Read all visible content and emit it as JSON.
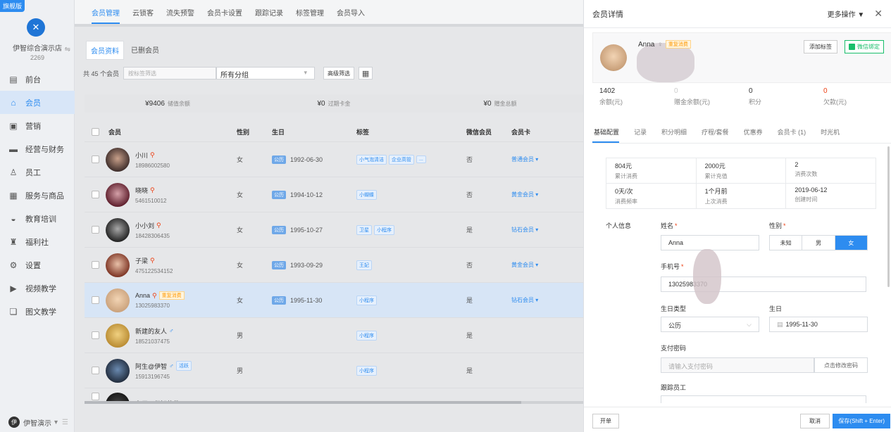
{
  "sidebar": {
    "badge": "旗舰版",
    "store_name": "伊智综合演示店",
    "store_id": "2269",
    "switch_icon": "switch-icon",
    "items": [
      {
        "label": "前台",
        "icon": "desk-icon"
      },
      {
        "label": "会员",
        "icon": "member-icon",
        "active": true
      },
      {
        "label": "营销",
        "icon": "marketing-icon"
      },
      {
        "label": "经营与财务",
        "icon": "finance-icon"
      },
      {
        "label": "员工",
        "icon": "staff-icon"
      },
      {
        "label": "服务与商品",
        "icon": "goods-icon"
      },
      {
        "label": "教育培训",
        "icon": "education-icon"
      },
      {
        "label": "福利社",
        "icon": "welfare-icon"
      },
      {
        "label": "设置",
        "icon": "settings-icon"
      },
      {
        "label": "视频教学",
        "icon": "video-icon"
      },
      {
        "label": "图文教学",
        "icon": "article-icon"
      }
    ],
    "user": "伊智演示",
    "user_avatar_text": "伊"
  },
  "topnav": [
    "会员管理",
    "云锁客",
    "流失预警",
    "会员卡设置",
    "跟踪记录",
    "标签管理",
    "会员导入"
  ],
  "subtabs": [
    "会员资料",
    "已删会员"
  ],
  "filter": {
    "count": "共 45 个会员",
    "placeholder": "按标签筛选",
    "group": "所有分组",
    "advanced": "高级筛选"
  },
  "summary": [
    {
      "value": "¥9406",
      "label": "储值余额"
    },
    {
      "value": "¥0",
      "label": "过期卡金"
    },
    {
      "value": "¥0",
      "label": "赠金总额"
    }
  ],
  "table": {
    "headers": [
      "会员",
      "性别",
      "生日",
      "标签",
      "微信会员",
      "会员卡"
    ],
    "rows": [
      {
        "name": "小川",
        "phone": "18986002580",
        "gender": "女",
        "gicon": "female",
        "cal": "公历",
        "birthday": "1992-06-30",
        "tags": [
          "小气泡清洁",
          "企业高管",
          "..."
        ],
        "wechat": "否",
        "card": "普通会员",
        "avatar": [
          "#3a2a28",
          "#c8a08a"
        ]
      },
      {
        "name": "晓晓",
        "phone": "5461510012",
        "gender": "女",
        "gicon": "female",
        "cal": "公历",
        "birthday": "1994-10-12",
        "tags": [
          "小蝴蝶"
        ],
        "wechat": "否",
        "card": "黄金会员",
        "avatar": [
          "#5a1a28",
          "#d4a0a8"
        ]
      },
      {
        "name": "小小刘",
        "phone": "18428306435",
        "gender": "女",
        "gicon": "female",
        "cal": "公历",
        "birthday": "1995-10-27",
        "tags": [
          "卫星",
          "小程序"
        ],
        "wechat": "是",
        "card": "钻石会员",
        "avatar": [
          "#1e1e1e",
          "#a8a8a8"
        ]
      },
      {
        "name": "子梁",
        "phone": "475122534152",
        "gender": "女",
        "gicon": "female",
        "cal": "公历",
        "birthday": "1993-09-29",
        "tags": [
          "王妃"
        ],
        "wechat": "否",
        "card": "黄金会员",
        "avatar": [
          "#7a3020",
          "#e8c0a8"
        ]
      },
      {
        "name": "Anna",
        "phone": "13025983370",
        "gender": "女",
        "gicon": "female",
        "cal": "公历",
        "birthday": "1995-11-30",
        "tags": [
          "小程序"
        ],
        "wechat": "是",
        "card": "钻石会员",
        "badge": "重复消费",
        "highlight": true,
        "avatar": [
          "#c9a07a",
          "#f2d4b4"
        ]
      },
      {
        "name": "新建的友人",
        "phone": "18521037475",
        "gender": "男",
        "gicon": "male",
        "cal": "",
        "birthday": "",
        "tags": [
          "小程序"
        ],
        "wechat": "是",
        "card": "",
        "avatar": [
          "#b88a30",
          "#f0d080"
        ]
      },
      {
        "name": "阿生@伊智",
        "phone": "15913196745",
        "gender": "男",
        "gicon": "male",
        "cal": "",
        "birthday": "",
        "tags": [
          "小程序"
        ],
        "wechat": "是",
        "card": "",
        "badge2": "活跃",
        "avatar": [
          "#202a3a",
          "#6a8ab0"
        ]
      },
      {
        "name": "东子@伊智软件",
        "phone": "",
        "gender": "",
        "gicon": "male",
        "cal": "",
        "birthday": "",
        "tags": [],
        "wechat": "",
        "card": "",
        "avatar": [
          "#111",
          "#444"
        ]
      }
    ]
  },
  "panel": {
    "title": "会员详情",
    "more": "更多操作",
    "name": "Anna",
    "name_badge": "重复消费",
    "add_tag": "添加标签",
    "wechat_bind": "微信绑定",
    "stats": [
      {
        "value": "1402",
        "label": "余额(元)",
        "style": ""
      },
      {
        "value": "0",
        "label": "赠金余额(元)",
        "style": "gray"
      },
      {
        "value": "0",
        "label": "积分",
        "style": ""
      },
      {
        "value": "0",
        "label": "欠款(元)",
        "style": "red"
      }
    ],
    "tabs": [
      "基础配置",
      "记录",
      "积分明细",
      "疗程/套餐",
      "优惠券",
      "会员卡 (1)",
      "时光机"
    ],
    "summary": [
      [
        {
          "v": "804元",
          "l": "累计消费"
        },
        {
          "v": "2000元",
          "l": "累计充值"
        },
        {
          "v": "2",
          "l": "消费次数"
        }
      ],
      [
        {
          "v": "0天/次",
          "l": "消费频率"
        },
        {
          "v": "1个月前",
          "l": "上次消费"
        },
        {
          "v": "2019-06-12",
          "l": "创建时间"
        }
      ]
    ],
    "form": {
      "section": "个人信息",
      "name_label": "姓名",
      "name_value": "Anna",
      "gender_label": "性别",
      "gender_options": [
        "未知",
        "男",
        "女"
      ],
      "phone_label": "手机号",
      "phone_value": "13025983370",
      "bdtype_label": "生日类型",
      "bdtype_value": "公历",
      "bd_label": "生日",
      "bd_value": "1995-11-30",
      "pwd_label": "支付密码",
      "pwd_placeholder": "请输入支付密码",
      "pwd_btn": "点击修改密码",
      "staff_label": "跟踪员工"
    },
    "footer": {
      "open": "开单",
      "cancel": "取消",
      "save": "保存(Shift + Enter)"
    }
  }
}
